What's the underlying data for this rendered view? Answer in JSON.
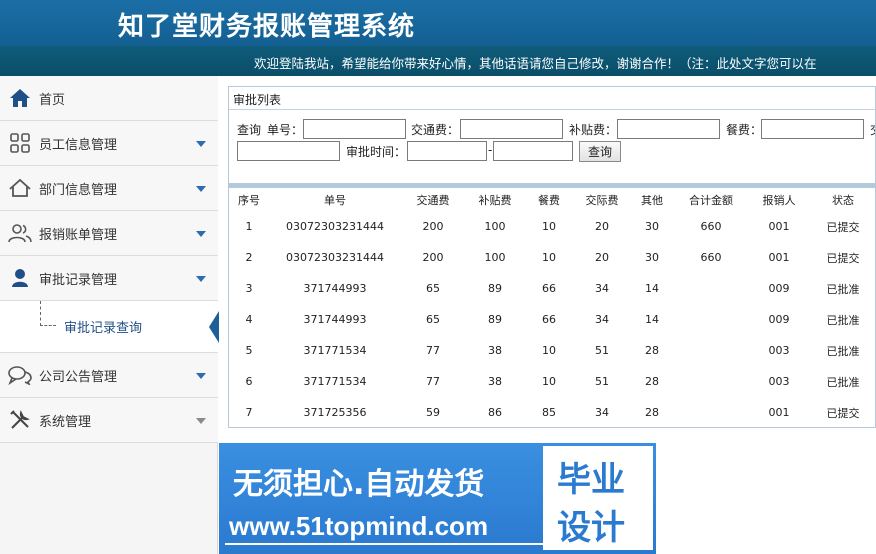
{
  "header": {
    "title": "知了堂财务报账管理系统",
    "notice": "欢迎登陆我站，希望能给你带来好心情，其他话语请您自己修改，谢谢合作！（注：此处文字您可以在"
  },
  "sidebar": {
    "items": [
      {
        "label": "首页",
        "icon": "home-icon"
      },
      {
        "label": "员工信息管理",
        "icon": "grid-icon"
      },
      {
        "label": "部门信息管理",
        "icon": "house-icon"
      },
      {
        "label": "报销账单管理",
        "icon": "users-icon"
      },
      {
        "label": "审批记录管理",
        "icon": "user-icon"
      },
      {
        "label": "公司公告管理",
        "icon": "chat-icon"
      },
      {
        "label": "系统管理",
        "icon": "tools-icon"
      }
    ],
    "submenu": {
      "label": "审批记录查询"
    }
  },
  "panel": {
    "title": "审批列表",
    "query": {
      "query_label": "查询",
      "bill_no_label": "单号：",
      "traffic_label": "交通费：",
      "subsidy_label": "补贴费：",
      "meal_label": "餐费：",
      "social_label_partial": "交",
      "approve_time_label": "审批时间：",
      "range_sep": "-",
      "search_button": "查询"
    },
    "table": {
      "headers": [
        "序号",
        "单号",
        "交通费",
        "补贴费",
        "餐费",
        "交际费",
        "其他",
        "合计金额",
        "报销人",
        "状态"
      ],
      "rows": [
        [
          "1",
          "03072303231444",
          "200",
          "100",
          "10",
          "20",
          "30",
          "660",
          "001",
          "已提交"
        ],
        [
          "2",
          "03072303231444",
          "200",
          "100",
          "10",
          "20",
          "30",
          "660",
          "001",
          "已提交"
        ],
        [
          "3",
          "371744993",
          "65",
          "89",
          "66",
          "34",
          "14",
          "",
          "009",
          "已批准"
        ],
        [
          "4",
          "371744993",
          "65",
          "89",
          "66",
          "34",
          "14",
          "",
          "009",
          "已批准"
        ],
        [
          "5",
          "371771534",
          "77",
          "38",
          "10",
          "51",
          "28",
          "",
          "003",
          "已批准"
        ],
        [
          "6",
          "371771534",
          "77",
          "38",
          "10",
          "51",
          "28",
          "",
          "003",
          "已批准"
        ],
        [
          "7",
          "371725356",
          "59",
          "86",
          "85",
          "34",
          "28",
          "",
          "001",
          "已提交"
        ]
      ]
    }
  },
  "banner": {
    "line1": "无须担心.自动发货",
    "line2": "www.51topmind.com",
    "badge_top": "毕业",
    "badge_bottom": "设计"
  },
  "colors": {
    "header_bg": "#1b6fa6",
    "notice_bg": "#0f5c7a",
    "accent": "#2a6db0",
    "banner_bg": "#3a8fe0"
  }
}
